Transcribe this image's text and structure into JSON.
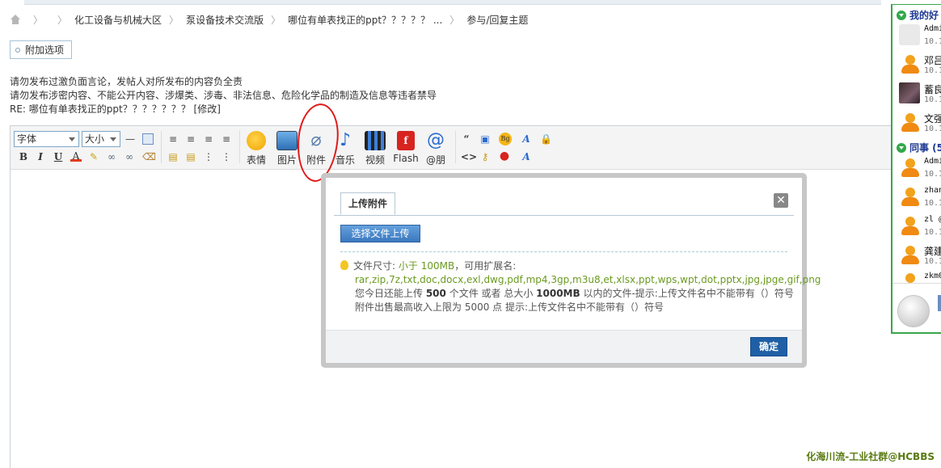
{
  "breadcrumb": {
    "items": [
      "化工设备与机械大区",
      "泵设备技术交流版",
      "哪位有单表找正的ppt？？？？？ ...",
      "参与/回复主题"
    ]
  },
  "addon_button": "附加选项",
  "notice": {
    "line1": "请勿发布过激负面言论，发帖人对所发布的内容负全责",
    "line2": "请勿发布涉密内容、不能公开内容、涉爆类、涉毒、非法信息、危险化学品的制造及信息等违者禁导",
    "reply_prefix": "RE: 哪位有单表找正的ppt？？？？？？？",
    "edit_link": "[修改]"
  },
  "toolbar": {
    "font_select": "字体",
    "size_select": "大小",
    "tools": [
      "表情",
      "图片",
      "附件",
      "音乐",
      "视频",
      "Flash",
      "@朋"
    ]
  },
  "dialog": {
    "tab": "上传附件",
    "close": "✕",
    "upload_button": "选择文件上传",
    "size_label": "文件尺寸:",
    "size_value": "小于 100MB",
    "ext_label": "，可用扩展名:",
    "extensions": "rar,zip,7z,txt,doc,docx,exl,dwg,pdf,mp4,3gp,m3u8,et,xlsx,ppt,wps,wpt,dot,pptx,jpg,jpge,gif,png",
    "today_a": "您今日还能上传 ",
    "today_count": "500",
    "today_b": " 个文件 或者 总大小 ",
    "today_size": "1000MB",
    "today_c": " 以内的文件-提示:上传文件名中不能带有（）符号",
    "sale_line": "附件出售最高收入上限为 5000 点     提示:上传文件名中不能带有（）符号",
    "ok_button": "确定"
  },
  "chat": {
    "group1": "我的好",
    "group2": "同事 (5",
    "friends1": [
      {
        "name": "Admi",
        "time": "10.1"
      },
      {
        "name": "邓吕",
        "time": "10.1"
      },
      {
        "name": "蓄良",
        "time": "10.1"
      },
      {
        "name": "文强",
        "time": "10.1"
      }
    ],
    "friends2": [
      {
        "name": "Admi",
        "time": "10.1"
      },
      {
        "name": "zhan",
        "time": "10.1"
      },
      {
        "name": "zl @",
        "time": "10.1"
      },
      {
        "name": "龚建",
        "time": "10.1"
      },
      {
        "name": "zkm0",
        "time": ""
      }
    ]
  },
  "watermark": "化海川流-工业社群@HCBBS"
}
